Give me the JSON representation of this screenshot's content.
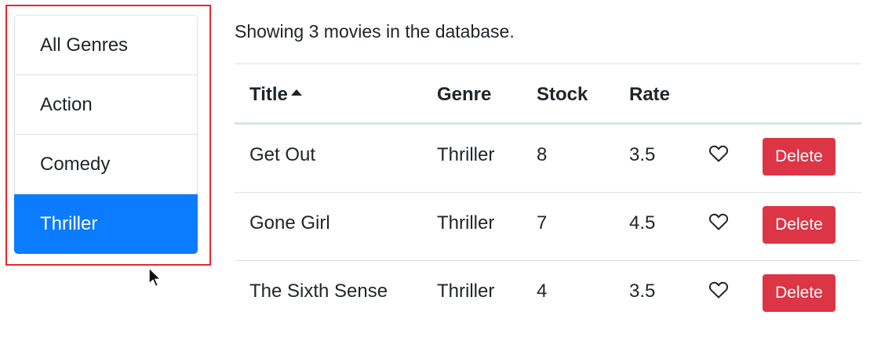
{
  "genres": {
    "items": [
      {
        "label": "All Genres",
        "active": false
      },
      {
        "label": "Action",
        "active": false
      },
      {
        "label": "Comedy",
        "active": false
      },
      {
        "label": "Thriller",
        "active": true
      }
    ]
  },
  "summary": "Showing 3 movies in the database.",
  "table": {
    "headers": {
      "title": "Title",
      "genre": "Genre",
      "stock": "Stock",
      "rate": "Rate"
    },
    "sort": {
      "column": "title",
      "direction": "ascending"
    },
    "rows": [
      {
        "title": "Get Out",
        "genre": "Thriller",
        "stock": "8",
        "rate": "3.5",
        "liked": false,
        "delete_label": "Delete"
      },
      {
        "title": "Gone Girl",
        "genre": "Thriller",
        "stock": "7",
        "rate": "4.5",
        "liked": false,
        "delete_label": "Delete"
      },
      {
        "title": "The Sixth Sense",
        "genre": "Thriller",
        "stock": "4",
        "rate": "3.5",
        "liked": false,
        "delete_label": "Delete"
      }
    ]
  },
  "colors": {
    "active_genre": "#0b7bff",
    "delete_button": "#dc3545",
    "highlight_box": "#e8262b"
  },
  "icons": {
    "sort": "caret-up-icon",
    "like": "heart-outline-icon",
    "cursor": "mouse-pointer-icon"
  }
}
